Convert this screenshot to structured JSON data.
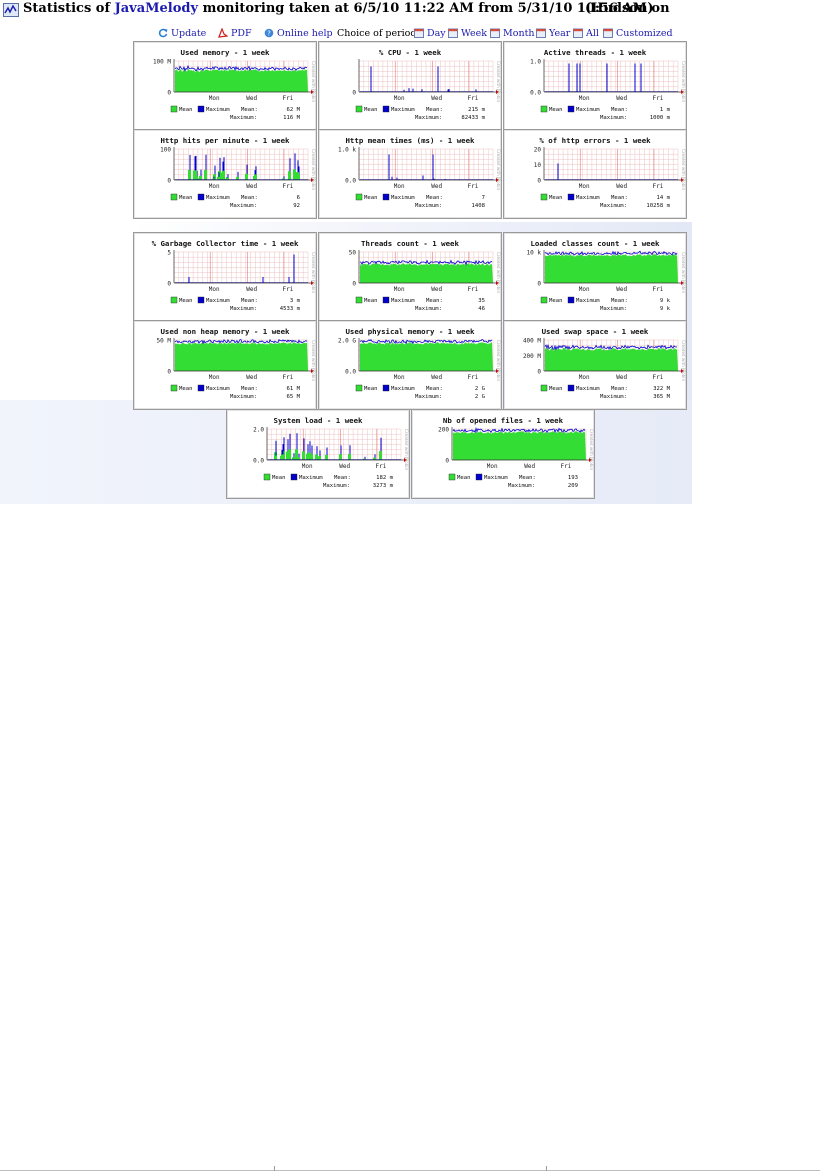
{
  "header": {
    "prefix": "Statistics of ",
    "brand": "JavaMelody",
    "suffix": " monitoring taken at 6/5/10 11:22 AM from 5/31/10 10:56 AM on",
    "hostname": "(Hudson)"
  },
  "menu": {
    "update": "Update",
    "pdf": "PDF",
    "help": "Online help",
    "choice": "Choice of period :",
    "periods": [
      "Day",
      "Week",
      "Month",
      "Year",
      "All",
      "Customized"
    ]
  },
  "colors": {
    "mean": "#33dd33",
    "maximum": "#0000cc",
    "grid": "#e8b4b4",
    "link": "#1b1bb0"
  },
  "legend": {
    "mean": "Mean",
    "maximum": "Maximum",
    "mean_label": "Mean:",
    "max_label": "Maximum:"
  },
  "x_ticks": [
    "Mon",
    "Wed",
    "Fri"
  ],
  "watermark": "Created with JRobin",
  "charts": [
    {
      "title": "Used memory - 1 week",
      "y_ticks": [
        "100 M",
        "0"
      ],
      "mean": "62 M",
      "maximum": "116 M",
      "kind": "area_high"
    },
    {
      "title": "% CPU - 1 week",
      "y_ticks": [
        "0"
      ],
      "mean": "215 m",
      "maximum": "82433 m",
      "kind": "spikes_low"
    },
    {
      "title": "Active threads - 1 week",
      "y_ticks": [
        "1.0",
        "0.0"
      ],
      "mean": "1 m",
      "maximum": "1000 m",
      "kind": "spikes_tall"
    },
    {
      "title": "Http hits per minute - 1 week",
      "y_ticks": [
        "100",
        "0"
      ],
      "mean": "6",
      "maximum": "92",
      "kind": "mixed"
    },
    {
      "title": "Http mean times (ms) - 1 week",
      "y_ticks": [
        "1.0 k",
        "0.0"
      ],
      "mean": "7",
      "maximum": "1408",
      "kind": "spikes_low"
    },
    {
      "title": "% of http errors - 1 week",
      "y_ticks": [
        "20",
        "10",
        "0"
      ],
      "mean": "14 m",
      "maximum": "10258 m",
      "kind": "one_spike"
    },
    {
      "title": "% Garbage Collector time - 1 week",
      "y_ticks": [
        "5",
        "0"
      ],
      "mean": "3 m",
      "maximum": "4533 m",
      "kind": "gc"
    },
    {
      "title": "Threads count - 1 week",
      "y_ticks": [
        "50",
        "0"
      ],
      "mean": "35",
      "maximum": "46",
      "kind": "area_mid"
    },
    {
      "title": "Loaded classes count - 1 week",
      "y_ticks": [
        "10 k",
        "0"
      ],
      "mean": "9 k",
      "maximum": "9 k",
      "kind": "area_full"
    },
    {
      "title": "Used non heap memory - 1 week",
      "y_ticks": [
        "50 M",
        "0"
      ],
      "mean": "61 M",
      "maximum": "65 M",
      "kind": "area_full"
    },
    {
      "title": "Used physical memory - 1 week",
      "y_ticks": [
        "2.0 G",
        "0.0"
      ],
      "mean": "2 G",
      "maximum": "2 G",
      "kind": "area_full"
    },
    {
      "title": "Used swap space - 1 week",
      "y_ticks": [
        "400 M",
        "200 M",
        "0"
      ],
      "mean": "322 M",
      "maximum": "365 M",
      "kind": "area_high"
    },
    {
      "title": "System load - 1 week",
      "y_ticks": [
        "2.0",
        "0.0"
      ],
      "mean": "182 m",
      "maximum": "3273 m",
      "kind": "mixed"
    },
    {
      "title": "Nb of opened files - 1 week",
      "y_ticks": [
        "200",
        "0"
      ],
      "mean": "193",
      "maximum": "209",
      "kind": "area_full"
    }
  ]
}
